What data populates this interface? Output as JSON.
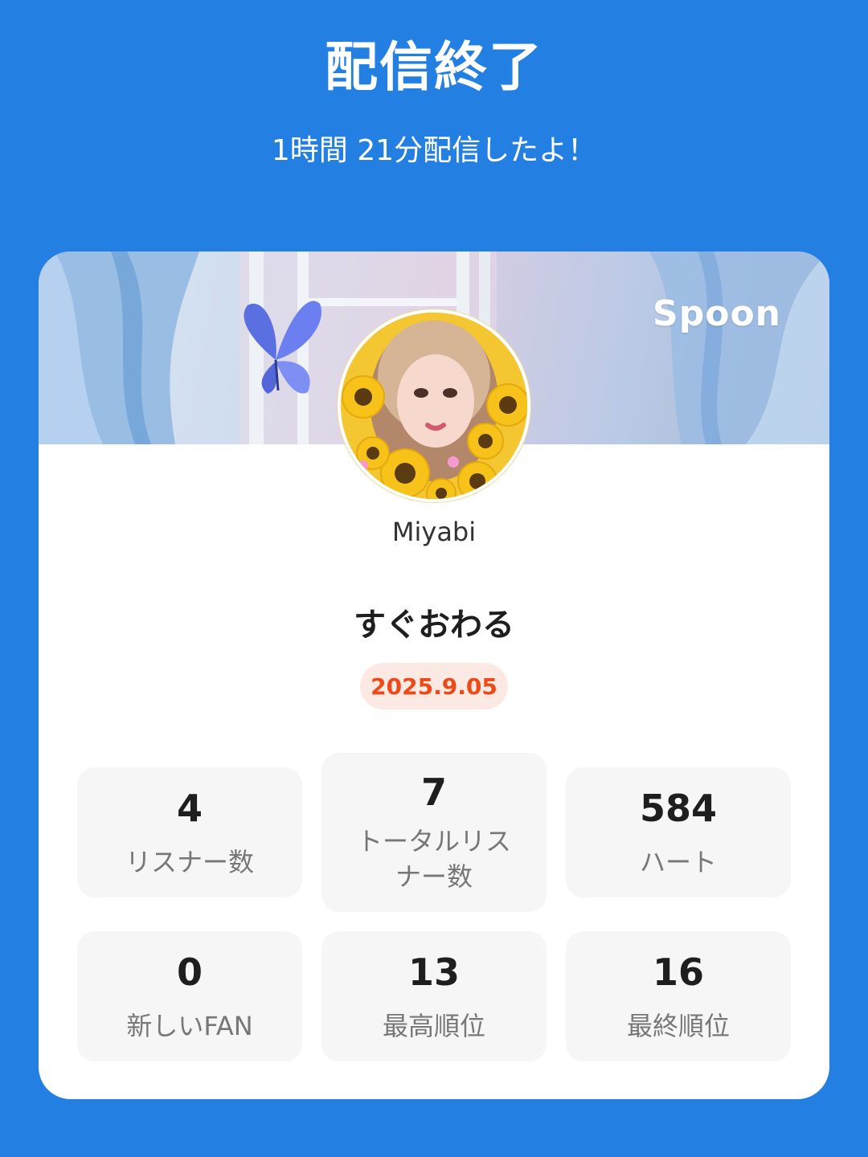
{
  "header": {
    "title": "配信終了",
    "subtitle": "1時間 21分配信したよ！"
  },
  "card": {
    "brand": "Spoon",
    "username": "Miyabi",
    "stream_title": "すぐおわる",
    "date": "2025.9.05",
    "stats": [
      {
        "value": "4",
        "label": "リスナー数"
      },
      {
        "value": "7",
        "label": "トータルリスナー数"
      },
      {
        "value": "584",
        "label": "ハート"
      },
      {
        "value": "0",
        "label": "新しいFAN"
      },
      {
        "value": "13",
        "label": "最高順位"
      },
      {
        "value": "16",
        "label": "最終順位"
      }
    ]
  },
  "colors": {
    "background": "#237fe2",
    "date_text": "#ec4a17",
    "date_badge": "#fde9e4",
    "stat_box": "#f6f6f6"
  }
}
